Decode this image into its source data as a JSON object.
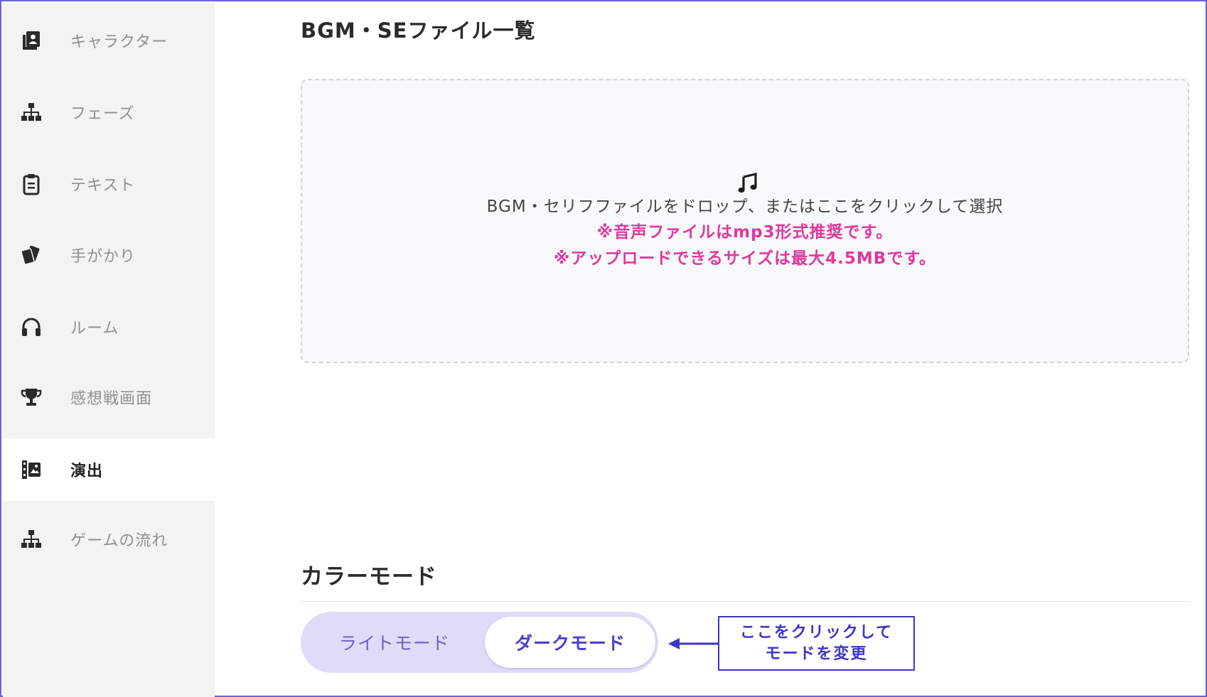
{
  "sidebar": {
    "items": [
      {
        "label": "キャラクター",
        "icon": "character-book-icon"
      },
      {
        "label": "フェーズ",
        "icon": "sitemap-icon"
      },
      {
        "label": "テキスト",
        "icon": "clipboard-icon"
      },
      {
        "label": "手がかり",
        "icon": "cards-icon"
      },
      {
        "label": "ルーム",
        "icon": "headphones-icon"
      },
      {
        "label": "感想戦画面",
        "icon": "trophy-icon"
      },
      {
        "label": "演出",
        "icon": "film-icon",
        "active": true
      },
      {
        "label": "ゲームの流れ",
        "icon": "sitemap-icon"
      }
    ]
  },
  "main": {
    "section_title": "BGM・SEファイル一覧",
    "dropzone": {
      "icon": "music-note-icon",
      "text": "BGM・セリフファイルをドロップ、またはここをクリックして選択",
      "note1": "※音声ファイルはmp3形式推奨です。",
      "note2": "※アップロードできるサイズは最大4.5MBです。"
    },
    "color_mode": {
      "title": "カラーモード",
      "light_label": "ライトモード",
      "dark_label": "ダークモード",
      "selected": "ダークモード"
    },
    "callout": {
      "line1": "ここをクリックして",
      "line2": "モードを変更"
    }
  },
  "colors": {
    "accent": "#4a3fcf",
    "warning_text": "#e0389d",
    "frame": "#6b62d6",
    "sidebar_bg": "#f3f3f4",
    "toggle_bg": "#dedcf8"
  }
}
